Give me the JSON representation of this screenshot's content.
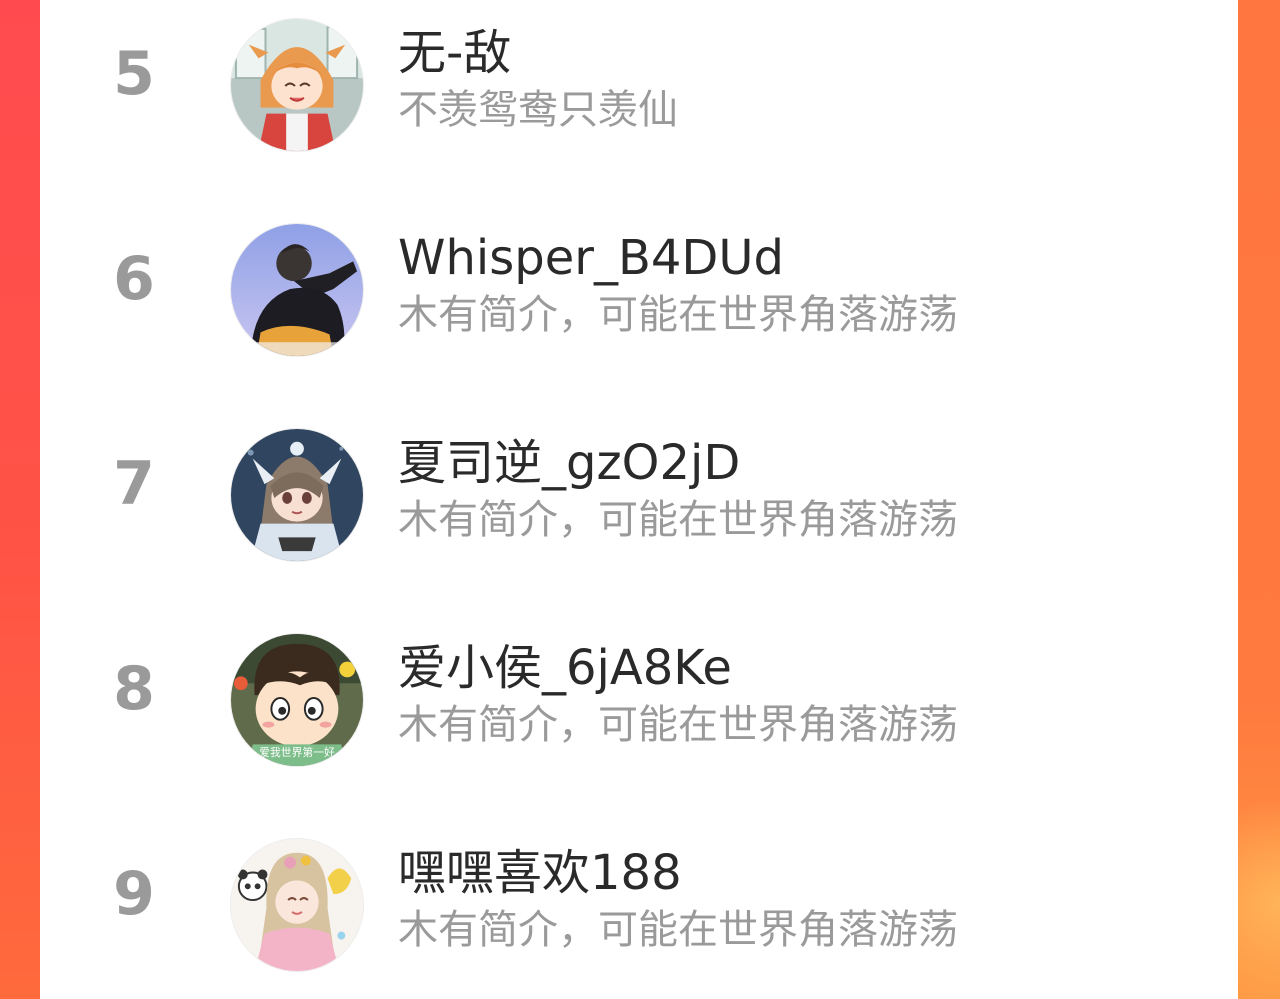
{
  "colors": {
    "accent_left": "#ff4b4f",
    "accent_right": "#ff7a3e",
    "rank_text": "#9a9a9a",
    "name_text": "#2a2a2a",
    "bio_text": "#9a9a9a"
  },
  "users": [
    {
      "rank": "5",
      "name": "无-敌",
      "bio": "不羡鸳鸯只羡仙",
      "avatar_icon": "anime-girl-avatar-icon"
    },
    {
      "rank": "6",
      "name": "Whisper_B4DUd",
      "bio": "木有简介，可能在世界角落游荡",
      "avatar_icon": "person-back-avatar-icon"
    },
    {
      "rank": "7",
      "name": "夏司逆_gzO2jD",
      "bio": "木有简介，可能在世界角落游荡",
      "avatar_icon": "chibi-character-avatar-icon"
    },
    {
      "rank": "8",
      "name": "爱小侯_6jA8Ke",
      "bio": "木有简介，可能在世界角落游荡",
      "avatar_icon": "cartoon-kid-avatar-icon",
      "avatar_caption": "爱我世界第一好"
    },
    {
      "rank": "9",
      "name": "嘿嘿喜欢188",
      "bio": "木有简介，可能在世界角落游荡",
      "avatar_icon": "pink-girl-panda-avatar-icon"
    }
  ]
}
